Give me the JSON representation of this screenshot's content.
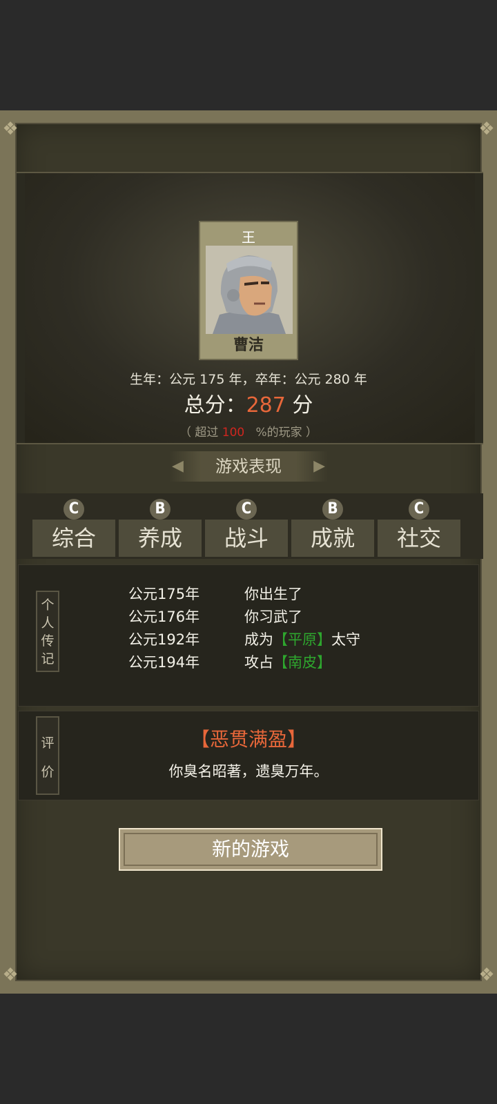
{
  "character": {
    "surname": "王",
    "name": "曹洁",
    "life_span": "生年：公元 175 年，卒年：公元 280 年"
  },
  "score": {
    "label": "总分：",
    "value": "287",
    "unit": "分",
    "exceed_prefix": "（ 超过",
    "exceed_value": "100",
    "exceed_suffix": "%的玩家 ）"
  },
  "section_title": "游戏表现",
  "grades": [
    {
      "grade": "C",
      "label": "综合"
    },
    {
      "grade": "B",
      "label": "养成"
    },
    {
      "grade": "C",
      "label": "战斗"
    },
    {
      "grade": "B",
      "label": "成就"
    },
    {
      "grade": "C",
      "label": "社交"
    }
  ],
  "bio_tag": "个人传记",
  "bio": [
    {
      "year": "公元175年",
      "pre": "你出生了",
      "highlight": "",
      "post": ""
    },
    {
      "year": "公元176年",
      "pre": "你习武了",
      "highlight": "",
      "post": ""
    },
    {
      "year": "公元192年",
      "pre": "成为",
      "highlight": "【平原】",
      "post": "太守"
    },
    {
      "year": "公元194年",
      "pre": "攻占",
      "highlight": "【南皮】",
      "post": ""
    }
  ],
  "eval_tag": "评价",
  "evaluation": {
    "title": "【恶贯满盈】",
    "text": "你臭名昭著，遗臭万年。"
  },
  "new_game_label": "新的游戏",
  "colors": {
    "score": "#e8673a",
    "highlight": "#2ea62e",
    "percent": "#d0261f"
  }
}
